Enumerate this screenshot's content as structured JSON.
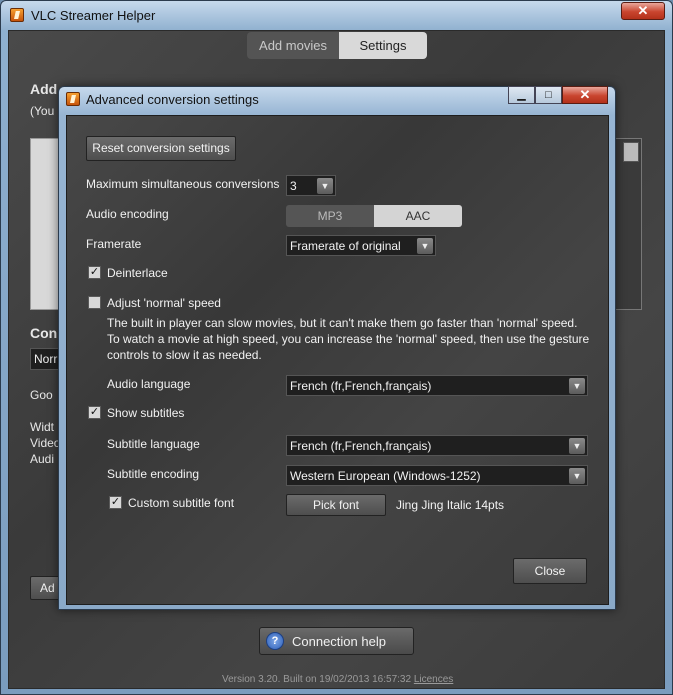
{
  "main": {
    "title": "VLC Streamer Helper",
    "close_glyph": "✕",
    "tabs": [
      {
        "label": "Add movies"
      },
      {
        "label": "Settings"
      }
    ],
    "background_fragments": {
      "add_heading": "Add",
      "you_note": "(You",
      "conv_heading": "Con",
      "norm_value": "Norr",
      "good_text": "Goo",
      "width_text": "Widt",
      "video_text": "Video",
      "audio_text": "Audi",
      "add_button": "Ad"
    },
    "connection_help_label": "Connection help",
    "shield_glyph": "?",
    "version_text": "Version 3.20. Built on 19/02/2013 16:57:32",
    "licences_link": "Licences"
  },
  "dialog": {
    "title": "Advanced conversion settings",
    "minimize_glyph": "▁",
    "maximize_glyph": "□",
    "close_glyph": "✕",
    "reset_button": "Reset conversion settings",
    "max_conversions_label": "Maximum simultaneous conversions",
    "max_conversions_value": "3",
    "audio_encoding_label": "Audio encoding",
    "audio_encoding_options": [
      "MP3",
      "AAC"
    ],
    "audio_encoding_selected": "AAC",
    "framerate_label": "Framerate",
    "framerate_value": "Framerate of original",
    "deinterlace_label": "Deinterlace",
    "deinterlace_checked": true,
    "adjust_speed_label": "Adjust 'normal' speed",
    "adjust_speed_checked": false,
    "speed_description_1": "The built in player can slow movies, but it can't make them go faster than 'normal' speed.",
    "speed_description_2": "To watch a movie at high speed, you can increase the 'normal' speed, then use the gesture",
    "speed_description_3": "controls to slow it as needed.",
    "audio_language_label": "Audio language",
    "audio_language_value": "French (fr,French,français)",
    "show_subtitles_label": "Show subtitles",
    "show_subtitles_checked": true,
    "subtitle_language_label": "Subtitle language",
    "subtitle_language_value": "French (fr,French,français)",
    "subtitle_encoding_label": "Subtitle encoding",
    "subtitle_encoding_value": "Western European (Windows-1252)",
    "custom_font_label": "Custom subtitle font",
    "custom_font_checked": true,
    "pick_font_button": "Pick font",
    "font_description": "Jing Jing Italic 14pts",
    "close_button": "Close",
    "check_glyph": "✓",
    "arrow_glyph": "▼"
  }
}
